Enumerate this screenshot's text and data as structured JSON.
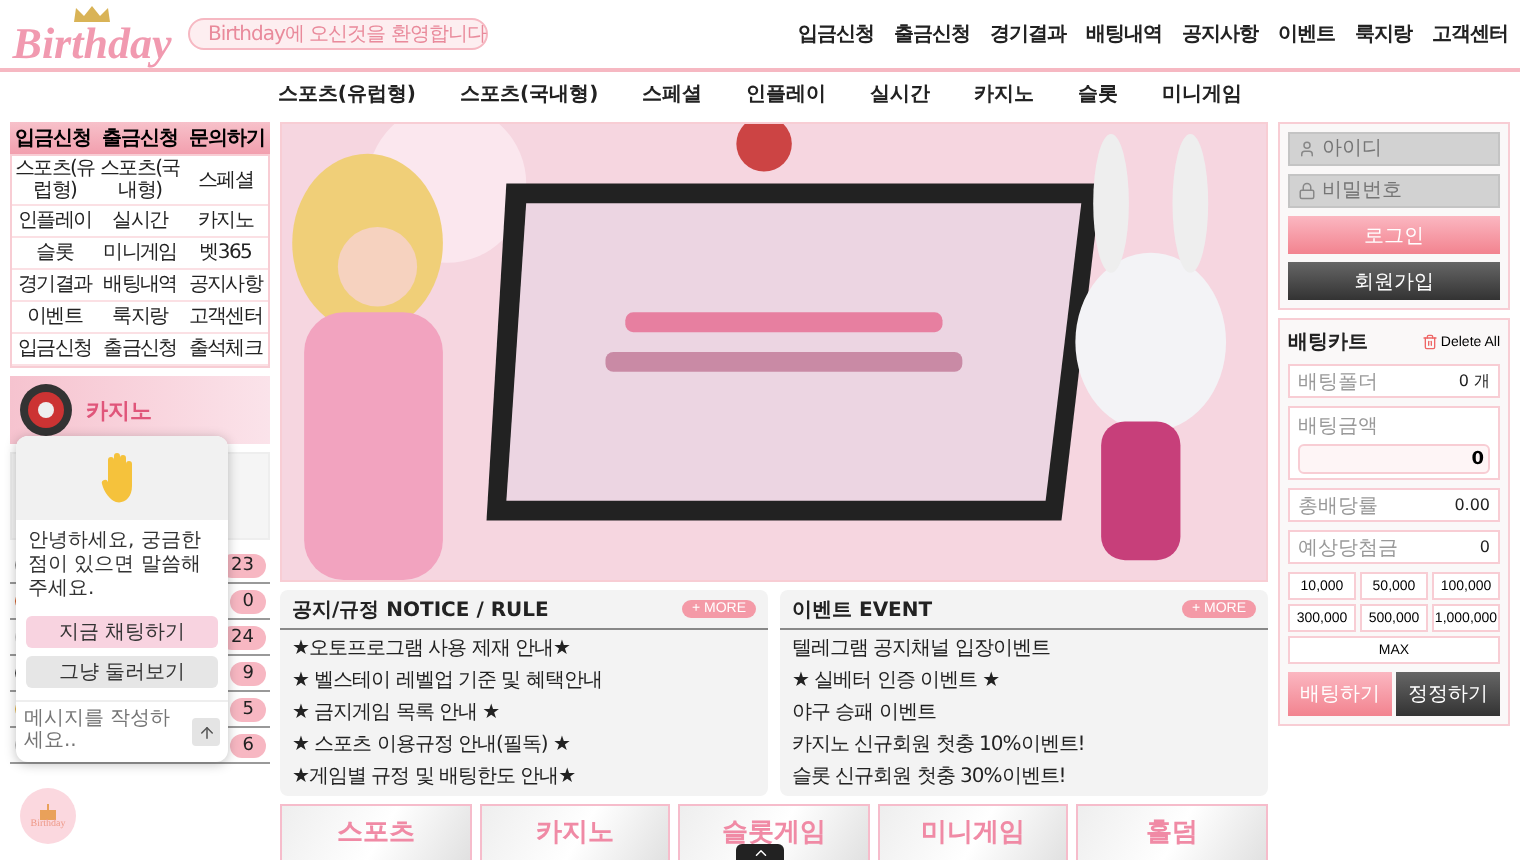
{
  "header": {
    "logo": "Birthday",
    "notice": "Birthday에 오신것을 환영합니다",
    "top_menu": [
      "입금신청",
      "출금신청",
      "경기결과",
      "배팅내역",
      "공지사항",
      "이벤트",
      "룩지랑",
      "고객센터"
    ]
  },
  "main_menu": [
    "스포츠(유럽형)",
    "스포츠(국내형)",
    "스페셜",
    "인플레이",
    "실시간",
    "카지노",
    "슬롯",
    "미니게임"
  ],
  "quick_buttons": [
    "입금신청",
    "출금신청",
    "문의하기"
  ],
  "side_links": [
    "스포츠(유럽형)",
    "스포츠(국내형)",
    "스페셜",
    "인플레이",
    "실시간",
    "카지노",
    "슬롯",
    "미니게임",
    "벳365",
    "경기결과",
    "배팅내역",
    "공지사항",
    "이벤트",
    "룩지랑",
    "고객센터",
    "입금신청",
    "출금신청",
    "출석체크"
  ],
  "casino_banner": {
    "label": "카지노"
  },
  "sports_list": [
    {
      "count": "23"
    },
    {
      "count": "0"
    },
    {
      "count": "24"
    },
    {
      "count": "9"
    },
    {
      "count": "5"
    },
    {
      "count": "6"
    }
  ],
  "banner": {
    "kind": "picture"
  },
  "boards": [
    {
      "title": "공지/규정 NOTICE / RULE",
      "more": "+ MORE",
      "items": [
        "★오토프로그램 사용 제재 안내★",
        "★ 벨스테이 레벨업 기준 및 혜택안내",
        "★ 금지게임 목록 안내 ★",
        "★ 스포츠 이용규정 안내(필독) ★",
        "★게임별 규정 및 배팅한도 안내★"
      ]
    },
    {
      "title": "이벤트 EVENT",
      "more": "+ MORE",
      "items": [
        "텔레그램 공지채널 입장이벤트",
        "★ 실베터 인증 이벤트 ★",
        "야구 승패 이벤트",
        "카지노 신규회원 첫충 10%이벤트!",
        "슬롯 신규회원 첫충 30%이벤트!"
      ]
    }
  ],
  "game_tiles": [
    "스포츠",
    "카지노",
    "슬롯게임",
    "미니게임",
    "홀덤"
  ],
  "login": {
    "id_placeholder": "아이디",
    "password_placeholder": "비밀번호",
    "login": "로그인",
    "signup": "회원가입"
  },
  "bet_cart": {
    "title": "배팅카트",
    "delete_all": "Delete All",
    "folder_label": "배팅폴더",
    "folder_value": "0 개",
    "amount_label": "배팅금액",
    "amount_value": "0",
    "odds_label": "총배당률",
    "odds_value": "0.00",
    "win_label": "예상당첨금",
    "win_value": "0",
    "amounts": [
      "10,000",
      "50,000",
      "100,000",
      "300,000",
      "500,000",
      "1,000,000"
    ],
    "max": "MAX",
    "bet": "배팅하기",
    "reset": "정정하기"
  },
  "chat": {
    "message": "안녕하세요, 궁금한 점이 있으면 말씀해주세요.",
    "chat_button": "지금 채팅하기",
    "browse_button": "그냥 둘러보기",
    "placeholder": "메시지를 작성하세요.."
  },
  "floating_button": {
    "label": "Birthday"
  }
}
